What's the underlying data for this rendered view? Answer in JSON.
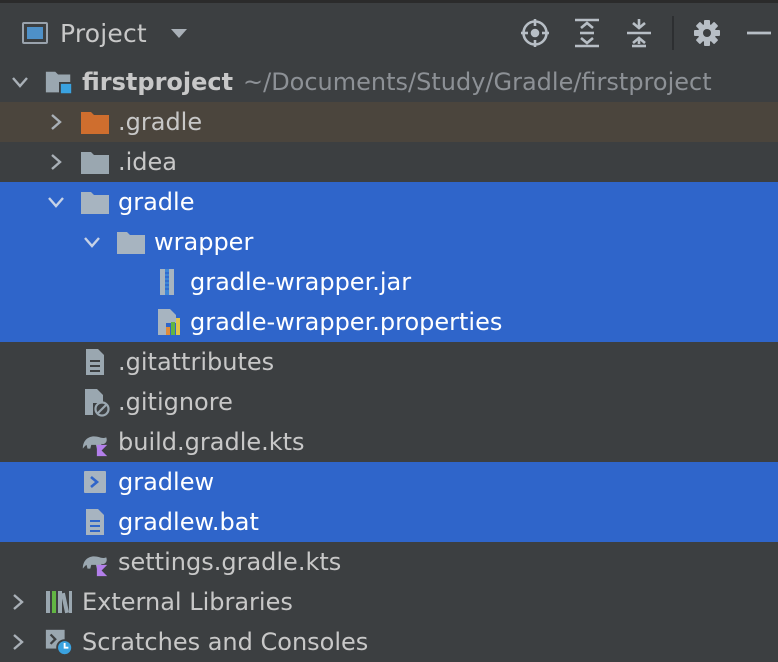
{
  "toolbar": {
    "title": "Project",
    "actions": [
      {
        "name": "select-opened-file",
        "icon": "crosshair-icon"
      },
      {
        "name": "expand-all",
        "icon": "expand-all-icon"
      },
      {
        "name": "collapse-all",
        "icon": "collapse-all-icon"
      },
      {
        "name": "settings",
        "icon": "gear-icon"
      },
      {
        "name": "hide",
        "icon": "minimize-icon"
      }
    ]
  },
  "tree": {
    "root": {
      "label": "firstproject",
      "path": "~/Documents/Study/Gradle/firstproject"
    },
    "items": [
      {
        "label": ".gradle",
        "icon": "folder-orange-icon",
        "state": "collapsed"
      },
      {
        "label": ".idea",
        "icon": "folder-icon",
        "state": "collapsed"
      },
      {
        "label": "gradle",
        "icon": "folder-icon",
        "state": "expanded",
        "selected": true
      },
      {
        "label": "wrapper",
        "icon": "folder-icon",
        "state": "expanded",
        "selected": true
      },
      {
        "label": "gradle-wrapper.jar",
        "icon": "jar-icon",
        "selected": true
      },
      {
        "label": "gradle-wrapper.properties",
        "icon": "properties-file-icon",
        "selected": true
      },
      {
        "label": ".gitattributes",
        "icon": "text-file-icon"
      },
      {
        "label": ".gitignore",
        "icon": "ignore-file-icon"
      },
      {
        "label": "build.gradle.kts",
        "icon": "gradle-kotlin-icon"
      },
      {
        "label": "gradlew",
        "icon": "shell-script-icon",
        "selected": true
      },
      {
        "label": "gradlew.bat",
        "icon": "text-file-icon",
        "selected": true
      },
      {
        "label": "settings.gradle.kts",
        "icon": "gradle-kotlin-icon"
      },
      {
        "label": "External Libraries",
        "icon": "libraries-icon",
        "state": "collapsed"
      },
      {
        "label": "Scratches and Consoles",
        "icon": "scratches-icon",
        "state": "collapsed"
      }
    ]
  },
  "colors": {
    "background": "#3c3f41",
    "selection": "#2f65ca",
    "ignored_row": "#4b453d",
    "folder": "#9aa7b0",
    "folder_excluded": "#cf6e2e"
  }
}
